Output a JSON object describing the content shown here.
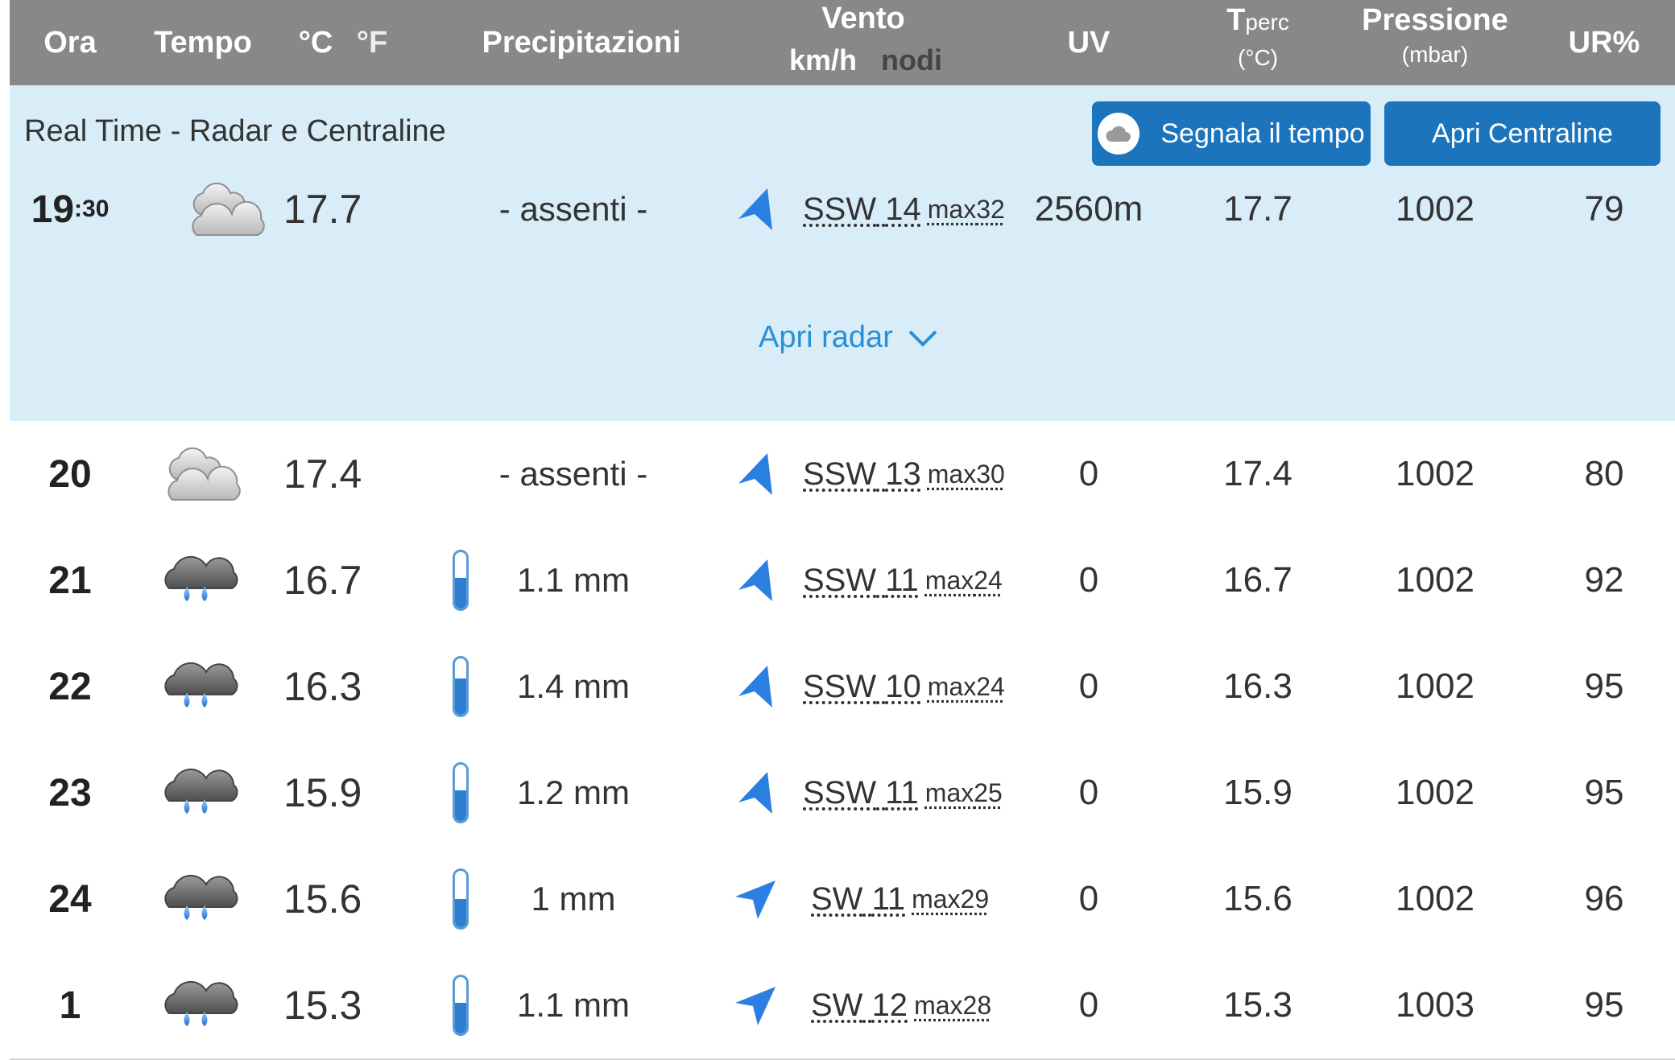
{
  "header": {
    "ora": "Ora",
    "tempo": "Tempo",
    "celsius": "°C",
    "fahrenheit": "°F",
    "precipitazioni": "Precipitazioni",
    "vento": "Vento",
    "kmh": "km/h",
    "nodi": "nodi",
    "uv": "UV",
    "tperc_t": "T",
    "tperc_sub": "perc",
    "tperc_unit": "(°C)",
    "pressione": "Pressione",
    "pressione_unit": "(mbar)",
    "ur": "UR%"
  },
  "realtime": {
    "title": "Real Time - Radar e Centraline",
    "segnala_label": "Segnala il tempo",
    "centraline_label": "Apri Centraline",
    "apri_radar": "Apri radar",
    "row": {
      "ora_h": "19",
      "ora_m": ":30",
      "icon": "cloudy-icon",
      "temp": "17.7",
      "prec": "- assenti -",
      "wind_dir": "SSW",
      "wind_speed": "14",
      "wind_max_label": "max",
      "wind_max": "32",
      "uv": "2560m",
      "tperc": "17.7",
      "pressione": "1002",
      "ur": "79"
    }
  },
  "rows": [
    {
      "ora": "20",
      "icon": "cloudy-icon",
      "temp": "17.4",
      "prec": "- assenti -",
      "gauge": null,
      "wind_dir": "SSW",
      "wind_speed": "13",
      "wind_max_label": "max",
      "wind_max": "30",
      "uv": "0",
      "tperc": "17.4",
      "pressione": "1002",
      "ur": "80"
    },
    {
      "ora": "21",
      "icon": "rain-icon",
      "temp": "16.7",
      "prec": "1.1 mm",
      "gauge": 0.55,
      "wind_dir": "SSW",
      "wind_speed": "11",
      "wind_max_label": "max",
      "wind_max": "24",
      "uv": "0",
      "tperc": "16.7",
      "pressione": "1002",
      "ur": "92"
    },
    {
      "ora": "22",
      "icon": "rain-icon",
      "temp": "16.3",
      "prec": "1.4 mm",
      "gauge": 0.65,
      "wind_dir": "SSW",
      "wind_speed": "10",
      "wind_max_label": "max",
      "wind_max": "24",
      "uv": "0",
      "tperc": "16.3",
      "pressione": "1002",
      "ur": "95"
    },
    {
      "ora": "23",
      "icon": "rain-icon",
      "temp": "15.9",
      "prec": "1.2 mm",
      "gauge": 0.55,
      "wind_dir": "SSW",
      "wind_speed": "11",
      "wind_max_label": "max",
      "wind_max": "25",
      "uv": "0",
      "tperc": "15.9",
      "pressione": "1002",
      "ur": "95"
    },
    {
      "ora": "24",
      "icon": "rain-icon",
      "temp": "15.6",
      "prec": "1 mm",
      "gauge": 0.5,
      "wind_dir": "SW",
      "wind_speed": "11",
      "wind_max_label": "max",
      "wind_max": "29",
      "uv": "0",
      "tperc": "15.6",
      "pressione": "1002",
      "ur": "96"
    },
    {
      "ora": "1",
      "icon": "rain-icon",
      "temp": "15.3",
      "prec": "1.1 mm",
      "gauge": 0.55,
      "wind_dir": "SW",
      "wind_speed": "12",
      "wind_max_label": "max",
      "wind_max": "28",
      "uv": "0",
      "tperc": "15.3",
      "pressione": "1003",
      "ur": "95"
    }
  ],
  "colors": {
    "header_bg": "#888888",
    "realtime_bg": "#d9edf8",
    "button_bg": "#1c75bc",
    "arrow": "#2a7fe0",
    "link": "#2a8fd4"
  }
}
